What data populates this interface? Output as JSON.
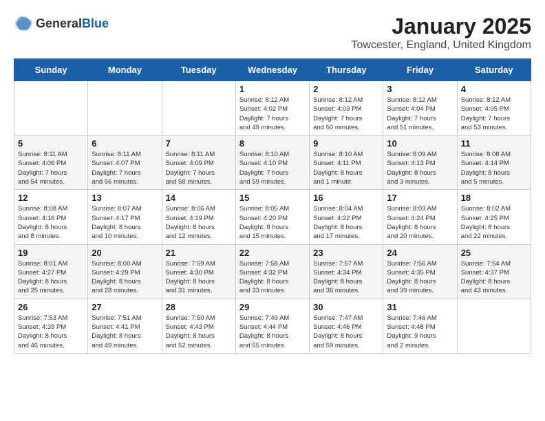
{
  "logo": {
    "general": "General",
    "blue": "Blue"
  },
  "title": "January 2025",
  "location": "Towcester, England, United Kingdom",
  "days_of_week": [
    "Sunday",
    "Monday",
    "Tuesday",
    "Wednesday",
    "Thursday",
    "Friday",
    "Saturday"
  ],
  "weeks": [
    [
      {
        "date": "",
        "info": ""
      },
      {
        "date": "",
        "info": ""
      },
      {
        "date": "",
        "info": ""
      },
      {
        "date": "1",
        "info": "Sunrise: 8:12 AM\nSunset: 4:02 PM\nDaylight: 7 hours\nand 49 minutes."
      },
      {
        "date": "2",
        "info": "Sunrise: 8:12 AM\nSunset: 4:03 PM\nDaylight: 7 hours\nand 50 minutes."
      },
      {
        "date": "3",
        "info": "Sunrise: 8:12 AM\nSunset: 4:04 PM\nDaylight: 7 hours\nand 51 minutes."
      },
      {
        "date": "4",
        "info": "Sunrise: 8:12 AM\nSunset: 4:05 PM\nDaylight: 7 hours\nand 53 minutes."
      }
    ],
    [
      {
        "date": "5",
        "info": "Sunrise: 8:11 AM\nSunset: 4:06 PM\nDaylight: 7 hours\nand 54 minutes."
      },
      {
        "date": "6",
        "info": "Sunrise: 8:11 AM\nSunset: 4:07 PM\nDaylight: 7 hours\nand 56 minutes."
      },
      {
        "date": "7",
        "info": "Sunrise: 8:11 AM\nSunset: 4:09 PM\nDaylight: 7 hours\nand 58 minutes."
      },
      {
        "date": "8",
        "info": "Sunrise: 8:10 AM\nSunset: 4:10 PM\nDaylight: 7 hours\nand 59 minutes."
      },
      {
        "date": "9",
        "info": "Sunrise: 8:10 AM\nSunset: 4:11 PM\nDaylight: 8 hours\nand 1 minute."
      },
      {
        "date": "10",
        "info": "Sunrise: 8:09 AM\nSunset: 4:13 PM\nDaylight: 8 hours\nand 3 minutes."
      },
      {
        "date": "11",
        "info": "Sunrise: 8:08 AM\nSunset: 4:14 PM\nDaylight: 8 hours\nand 5 minutes."
      }
    ],
    [
      {
        "date": "12",
        "info": "Sunrise: 8:08 AM\nSunset: 4:16 PM\nDaylight: 8 hours\nand 8 minutes."
      },
      {
        "date": "13",
        "info": "Sunrise: 8:07 AM\nSunset: 4:17 PM\nDaylight: 8 hours\nand 10 minutes."
      },
      {
        "date": "14",
        "info": "Sunrise: 8:06 AM\nSunset: 4:19 PM\nDaylight: 8 hours\nand 12 minutes."
      },
      {
        "date": "15",
        "info": "Sunrise: 8:05 AM\nSunset: 4:20 PM\nDaylight: 8 hours\nand 15 minutes."
      },
      {
        "date": "16",
        "info": "Sunrise: 8:04 AM\nSunset: 4:22 PM\nDaylight: 8 hours\nand 17 minutes."
      },
      {
        "date": "17",
        "info": "Sunrise: 8:03 AM\nSunset: 4:24 PM\nDaylight: 8 hours\nand 20 minutes."
      },
      {
        "date": "18",
        "info": "Sunrise: 8:02 AM\nSunset: 4:25 PM\nDaylight: 8 hours\nand 22 minutes."
      }
    ],
    [
      {
        "date": "19",
        "info": "Sunrise: 8:01 AM\nSunset: 4:27 PM\nDaylight: 8 hours\nand 25 minutes."
      },
      {
        "date": "20",
        "info": "Sunrise: 8:00 AM\nSunset: 4:29 PM\nDaylight: 8 hours\nand 28 minutes."
      },
      {
        "date": "21",
        "info": "Sunrise: 7:59 AM\nSunset: 4:30 PM\nDaylight: 8 hours\nand 31 minutes."
      },
      {
        "date": "22",
        "info": "Sunrise: 7:58 AM\nSunset: 4:32 PM\nDaylight: 8 hours\nand 33 minutes."
      },
      {
        "date": "23",
        "info": "Sunrise: 7:57 AM\nSunset: 4:34 PM\nDaylight: 8 hours\nand 36 minutes."
      },
      {
        "date": "24",
        "info": "Sunrise: 7:56 AM\nSunset: 4:35 PM\nDaylight: 8 hours\nand 39 minutes."
      },
      {
        "date": "25",
        "info": "Sunrise: 7:54 AM\nSunset: 4:37 PM\nDaylight: 8 hours\nand 43 minutes."
      }
    ],
    [
      {
        "date": "26",
        "info": "Sunrise: 7:53 AM\nSunset: 4:39 PM\nDaylight: 8 hours\nand 46 minutes."
      },
      {
        "date": "27",
        "info": "Sunrise: 7:51 AM\nSunset: 4:41 PM\nDaylight: 8 hours\nand 49 minutes."
      },
      {
        "date": "28",
        "info": "Sunrise: 7:50 AM\nSunset: 4:43 PM\nDaylight: 8 hours\nand 52 minutes."
      },
      {
        "date": "29",
        "info": "Sunrise: 7:49 AM\nSunset: 4:44 PM\nDaylight: 8 hours\nand 55 minutes."
      },
      {
        "date": "30",
        "info": "Sunrise: 7:47 AM\nSunset: 4:46 PM\nDaylight: 8 hours\nand 59 minutes."
      },
      {
        "date": "31",
        "info": "Sunrise: 7:46 AM\nSunset: 4:48 PM\nDaylight: 9 hours\nand 2 minutes."
      },
      {
        "date": "",
        "info": ""
      }
    ]
  ]
}
